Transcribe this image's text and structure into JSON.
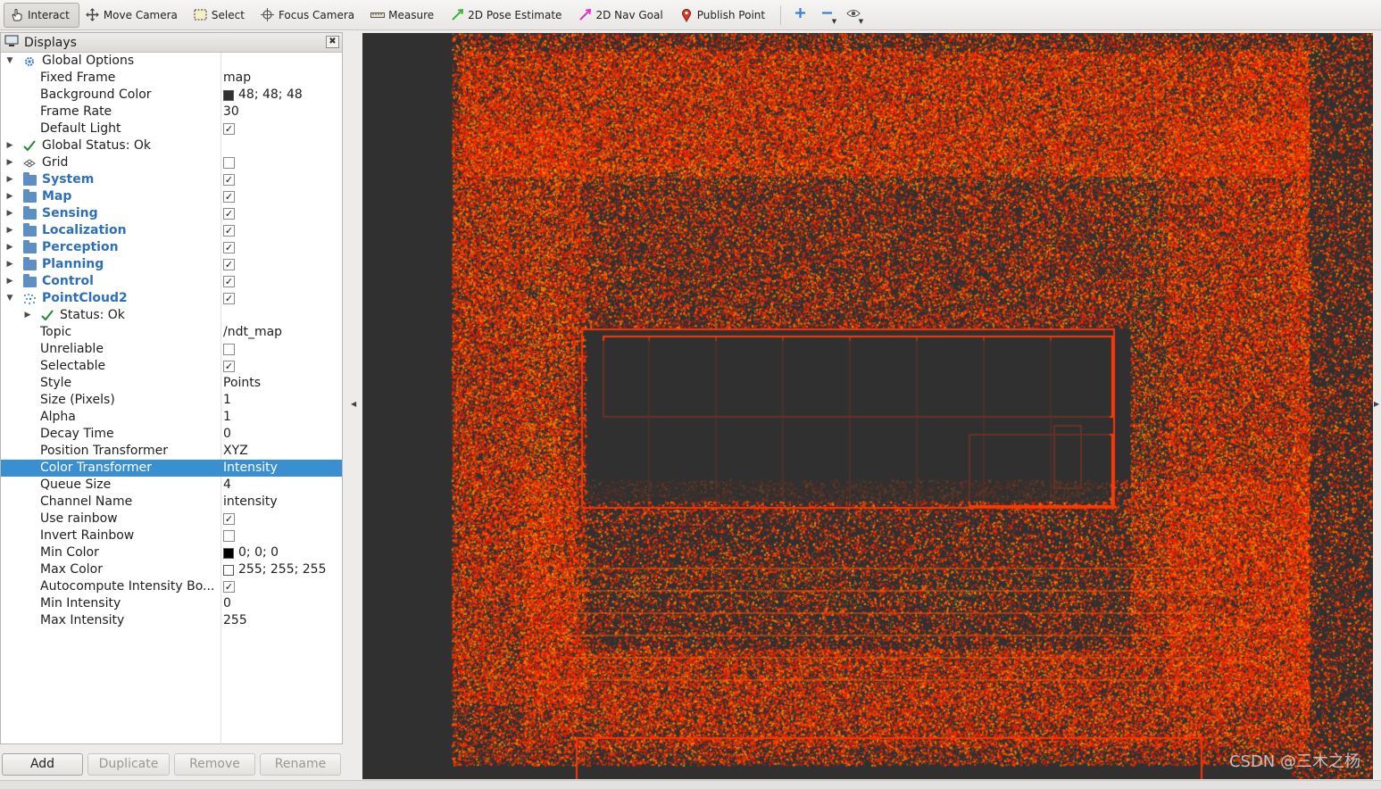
{
  "toolbar": {
    "interact": "Interact",
    "move_camera": "Move Camera",
    "select": "Select",
    "focus_camera": "Focus Camera",
    "measure": "Measure",
    "pose_estimate": "2D Pose Estimate",
    "nav_goal": "2D Nav Goal",
    "publish_point": "Publish Point"
  },
  "displays": {
    "title": "Displays",
    "close_glyph": "✖",
    "global_options": "Global Options",
    "fixed_frame": {
      "label": "Fixed Frame",
      "value": "map"
    },
    "background_color": {
      "label": "Background Color",
      "value": "48; 48; 48",
      "swatch": "#303030"
    },
    "frame_rate": {
      "label": "Frame Rate",
      "value": "30"
    },
    "default_light": {
      "label": "Default Light",
      "checked": "✓"
    },
    "global_status": "Global Status: Ok",
    "grid": {
      "label": "Grid",
      "checked": ""
    },
    "groups": [
      {
        "label": "System",
        "checked": "✓"
      },
      {
        "label": "Map",
        "checked": "✓"
      },
      {
        "label": "Sensing",
        "checked": "✓"
      },
      {
        "label": "Localization",
        "checked": "✓"
      },
      {
        "label": "Perception",
        "checked": "✓"
      },
      {
        "label": "Planning",
        "checked": "✓"
      },
      {
        "label": "Control",
        "checked": "✓"
      }
    ],
    "pointcloud": {
      "label": "PointCloud2",
      "checked": "✓",
      "status": "Status: Ok",
      "topic": {
        "label": "Topic",
        "value": "/ndt_map"
      },
      "unreliable": {
        "label": "Unreliable",
        "checked": ""
      },
      "selectable": {
        "label": "Selectable",
        "checked": "✓"
      },
      "style": {
        "label": "Style",
        "value": "Points"
      },
      "size": {
        "label": "Size (Pixels)",
        "value": "1"
      },
      "alpha": {
        "label": "Alpha",
        "value": "1"
      },
      "decay_time": {
        "label": "Decay Time",
        "value": "0"
      },
      "position_transformer": {
        "label": "Position Transformer",
        "value": "XYZ"
      },
      "color_transformer": {
        "label": "Color Transformer",
        "value": "Intensity"
      },
      "queue_size": {
        "label": "Queue Size",
        "value": "4"
      },
      "channel_name": {
        "label": "Channel Name",
        "value": "intensity"
      },
      "use_rainbow": {
        "label": "Use rainbow",
        "checked": "✓"
      },
      "invert_rainbow": {
        "label": "Invert Rainbow",
        "checked": ""
      },
      "min_color": {
        "label": "Min Color",
        "value": "0; 0; 0",
        "swatch": "#000000"
      },
      "max_color": {
        "label": "Max Color",
        "value": "255; 255; 255",
        "swatch": "#ffffff"
      },
      "autocompute": {
        "label": "Autocompute Intensity Bo...",
        "checked": "✓"
      },
      "min_intensity": {
        "label": "Min Intensity",
        "value": "0"
      },
      "max_intensity": {
        "label": "Max Intensity",
        "value": "255"
      }
    }
  },
  "buttons": {
    "add": "Add",
    "duplicate": "Duplicate",
    "remove": "Remove",
    "rename": "Rename"
  },
  "viewport": {
    "background": "#303030",
    "point_colors": [
      "#ff2a00",
      "#ff3d00",
      "#ee1c00",
      "#ff5a00",
      "#ff8800",
      "#d81800"
    ],
    "watermark": "CSDN @三木之杨"
  }
}
